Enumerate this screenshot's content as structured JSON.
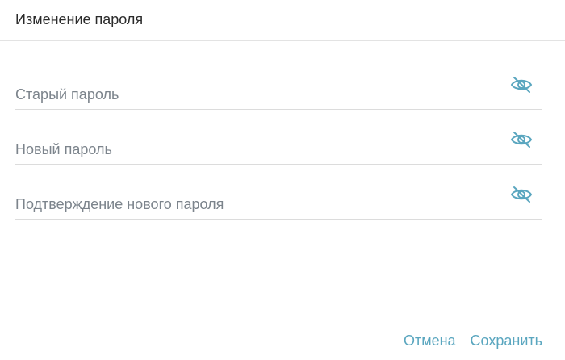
{
  "dialog": {
    "title": "Изменение пароля",
    "fields": [
      {
        "label": "Старый пароль",
        "icon": "eye-off-icon"
      },
      {
        "label": "Новый пароль",
        "icon": "eye-off-icon"
      },
      {
        "label": "Подтверждение нового пароля",
        "icon": "eye-off-icon"
      }
    ],
    "actions": {
      "cancel_label": "Отмена",
      "save_label": "Сохранить"
    }
  },
  "colors": {
    "accent": "#5aa6bf",
    "label": "#7c848c",
    "divider": "#dcdcdc"
  }
}
